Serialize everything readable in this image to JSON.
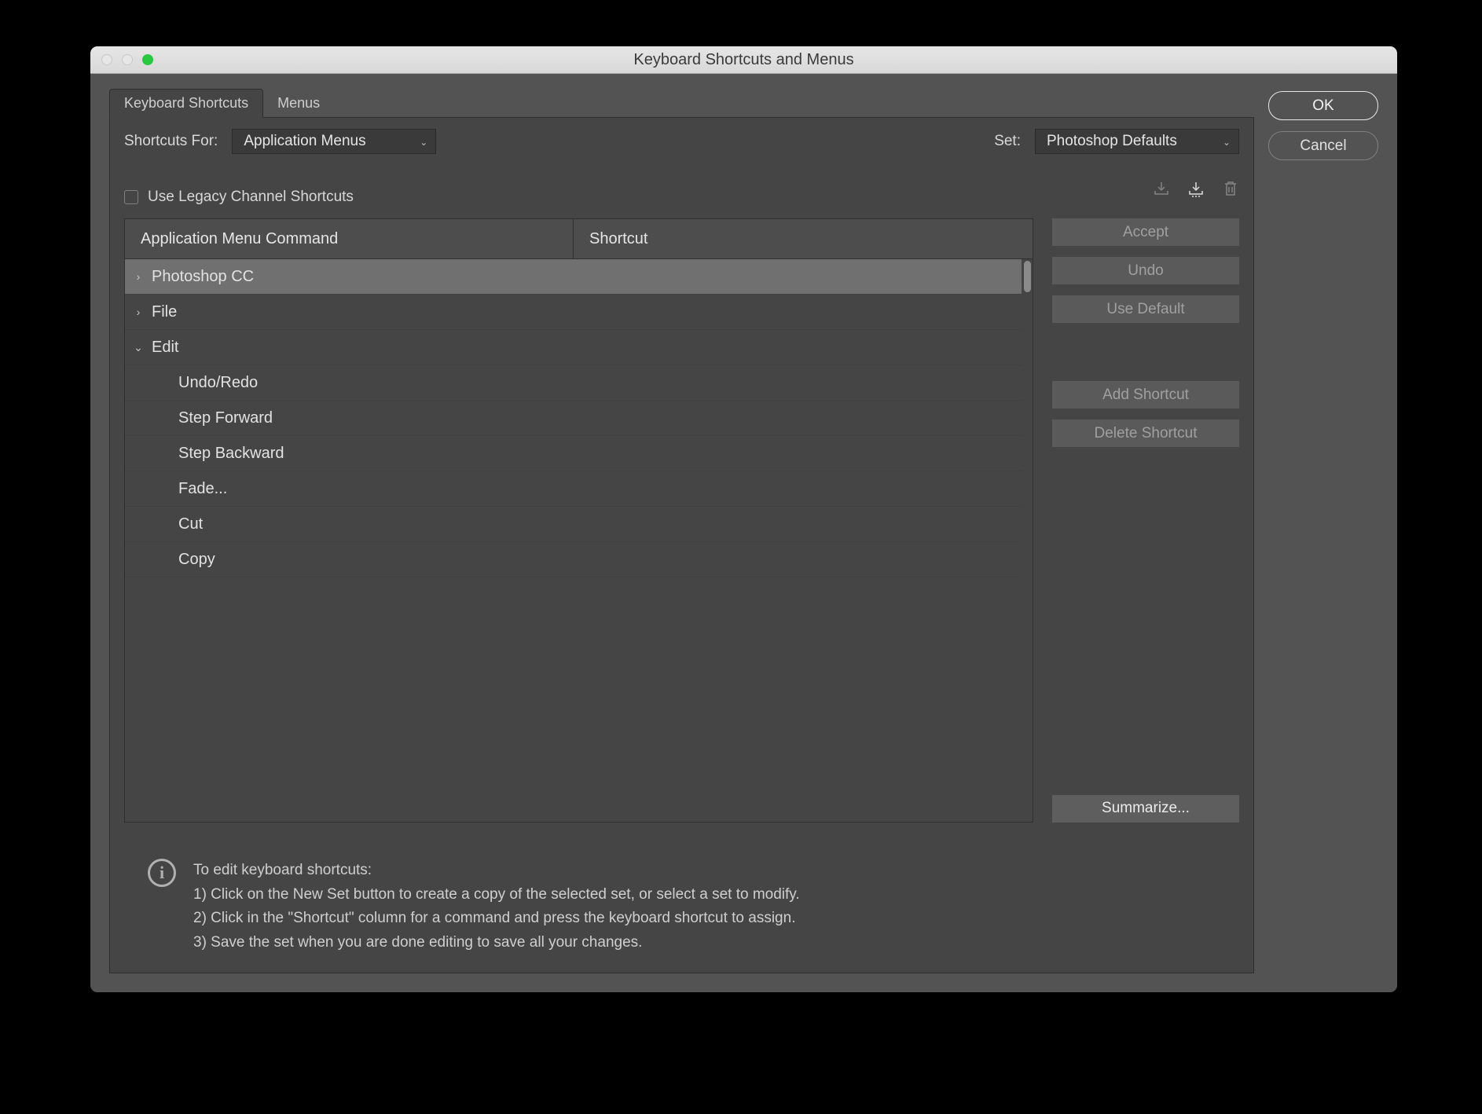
{
  "window": {
    "title": "Keyboard Shortcuts and Menus"
  },
  "tabs": {
    "keyboard": "Keyboard Shortcuts",
    "menus": "Menus"
  },
  "controls": {
    "shortcuts_for_label": "Shortcuts For:",
    "shortcuts_for_value": "Application Menus",
    "set_label": "Set:",
    "set_value": "Photoshop Defaults",
    "legacy_label": "Use Legacy Channel Shortcuts"
  },
  "columns": {
    "command": "Application Menu Command",
    "shortcut": "Shortcut"
  },
  "tree": [
    {
      "name": "Photoshop CC",
      "expanded": false,
      "indent": 0,
      "selected": true
    },
    {
      "name": "File",
      "expanded": false,
      "indent": 0
    },
    {
      "name": "Edit",
      "expanded": true,
      "indent": 0
    },
    {
      "name": "Undo/Redo",
      "indent": 1
    },
    {
      "name": "Step Forward",
      "indent": 1
    },
    {
      "name": "Step Backward",
      "indent": 1
    },
    {
      "name": "Fade...",
      "indent": 1
    },
    {
      "name": "Cut",
      "indent": 1
    },
    {
      "name": "Copy",
      "indent": 1
    }
  ],
  "buttons": {
    "accept": "Accept",
    "undo": "Undo",
    "use_default": "Use Default",
    "add": "Add Shortcut",
    "delete": "Delete Shortcut",
    "summarize": "Summarize..."
  },
  "side": {
    "ok": "OK",
    "cancel": "Cancel"
  },
  "info": {
    "title": "To edit keyboard shortcuts:",
    "line1": "1) Click on the New Set button to create a copy of the selected set, or select a set to modify.",
    "line2": "2) Click in the \"Shortcut\" column for a command and press the keyboard shortcut to assign.",
    "line3": "3) Save the set when you are done editing to save all your changes."
  }
}
